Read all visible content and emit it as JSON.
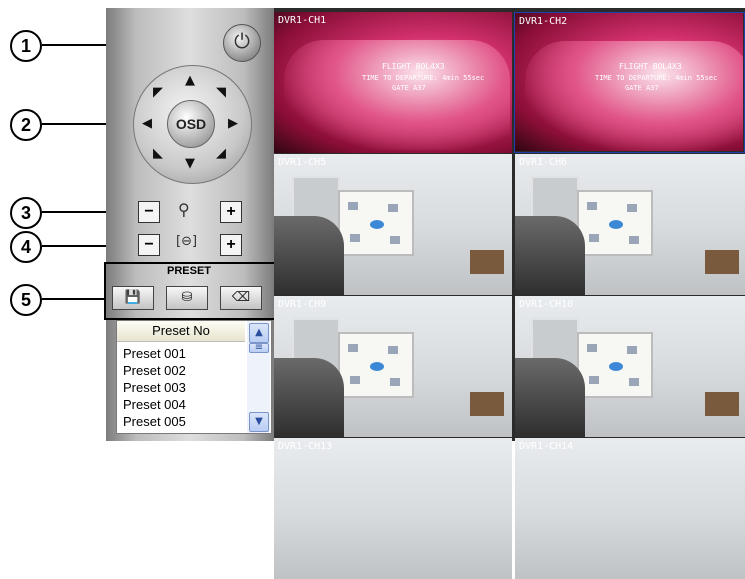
{
  "callouts": [
    "1",
    "2",
    "3",
    "4",
    "5"
  ],
  "controls": {
    "power_icon": "power-icon",
    "osd_label": "OSD",
    "arrows": {
      "up": "▲",
      "down": "▼",
      "left": "◀",
      "right": "▶",
      "up_left": "◤",
      "up_right": "◥",
      "down_left": "◣",
      "down_right": "◢"
    },
    "zoom": {
      "minus": "−",
      "plus": "+",
      "icon": "magnifier-icon"
    },
    "focus": {
      "minus": "−",
      "plus": "+",
      "icon": "focus-icon"
    }
  },
  "preset": {
    "title": "PRESET",
    "buttons": [
      {
        "icon": "save-preset-icon",
        "glyph": "💾"
      },
      {
        "icon": "goto-preset-icon",
        "glyph": "⛁"
      },
      {
        "icon": "delete-preset-icon",
        "glyph": "⌫"
      }
    ],
    "list": {
      "header": "Preset No",
      "items": [
        "Preset 001",
        "Preset 002",
        "Preset 003",
        "Preset 004",
        "Preset 005"
      ]
    }
  },
  "cameras": [
    {
      "label": "DVR1-CH1",
      "type": "pink",
      "texts": [
        "FLIGHT BOL4X3",
        "TIME TO DEPARTURE: 4min 55sec",
        "GATE A37"
      ]
    },
    {
      "label": "DVR1-CH2",
      "type": "pink",
      "texts": [
        "FLIGHT BOL4X3",
        "TIME TO DEPARTURE: 4min 55sec",
        "GATE A37"
      ]
    },
    {
      "label": "DVR1-CH5",
      "type": "office"
    },
    {
      "label": "DVR1-CH6",
      "type": "office"
    },
    {
      "label": "DVR1-CH9",
      "type": "office"
    },
    {
      "label": "DVR1-CH10",
      "type": "office"
    },
    {
      "label": "DVR1-CH13",
      "type": "office"
    },
    {
      "label": "DVR1-CH14",
      "type": "office"
    }
  ],
  "colors": {
    "selection_border": "#1e40b0",
    "pink_feed": "#d3316e"
  }
}
